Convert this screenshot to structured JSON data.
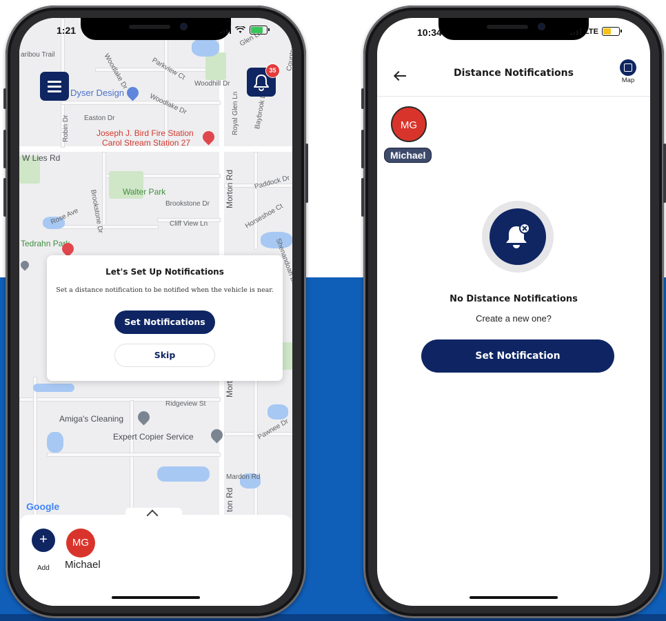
{
  "left_phone": {
    "status_time": "1:21",
    "menu_icon": "hamburger-menu-icon",
    "bell_icon": "bell-icon",
    "notification_badge": "35",
    "map_labels": {
      "dyser_design": "Dyser Design",
      "fire_station_1": "Joseph J. Bird Fire Station",
      "fire_station_2": "Carol Stream Station 27",
      "w_lies_rd": "W Lies Rd",
      "walter_park": "Walter Park",
      "brookstone_dr": "Brookstone Dr",
      "brookstone_dr_2": "Brookstone Dr",
      "cliff_view_ln": "Cliff View Ln",
      "paddock_dr": "Paddock Dr",
      "horseshoe_ct": "Horseshoe Ct",
      "morton_rd": "Morton Rd",
      "morton_rd_2": "Morton",
      "morton_rd_3": "ton Rd",
      "tedrahn_park": "Tedrahn Park",
      "easton_dr": "Easton Dr",
      "robin_dr": "Robin Dr",
      "rose_ave": "Rose Ave",
      "woodhill_dr": "Woodhill Dr",
      "woodlake_dr": "Woodlake Dr",
      "parkview_ct": "Parkview Ct",
      "royal_glen_ln": "Royal Glen Ln",
      "baybrook_ln": "Baybrook Ln",
      "shenandoah_dr": "Shenandoah Dr",
      "ridgeview_st": "Ridgeview St",
      "amigas_cleaning": "Amiga's Cleaning",
      "expert_copier": "Expert Copier Service",
      "pawnee_dr": "Pawnee Dr",
      "mardon_rd": "Mardon Rd",
      "caribou_trail": "aribou Trail",
      "glen_ln": "Glen Ln",
      "country": "Country"
    },
    "modal": {
      "title": "Let's Set Up Notifications",
      "text": "Set a distance notification to be notified when the vehicle is near.",
      "primary_button": "Set Notifications",
      "secondary_button": "Skip"
    },
    "map_attribution": "Google",
    "sheet": {
      "add_icon": "+",
      "add_label": "Add",
      "avatar_initials": "MG",
      "avatar_name": "Michael"
    }
  },
  "right_phone": {
    "status_time": "10:34",
    "network": "LTE",
    "header": {
      "back_icon": "back-arrow-icon",
      "title": "Distance Notifications",
      "map_label": "Map"
    },
    "avatar_initials": "MG",
    "avatar_name": "Michael",
    "empty_state": {
      "icon": "bell-cancel-icon",
      "title": "No Distance Notifications",
      "subtitle": "Create a new one?",
      "button": "Set Notification"
    }
  },
  "colors": {
    "primary_navy": "#0f2563",
    "avatar_red": "#d9342b",
    "background_blue": "#0f5eb8"
  }
}
